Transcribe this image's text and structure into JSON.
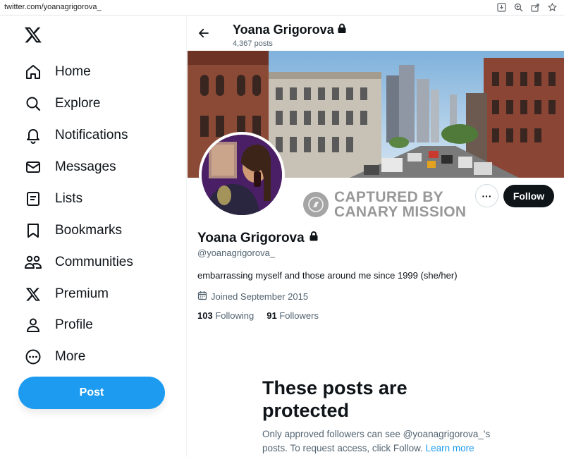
{
  "browser": {
    "url": "twitter.com/yoanagrigorova_"
  },
  "nav": {
    "items": [
      {
        "label": "Home",
        "icon": "home-icon"
      },
      {
        "label": "Explore",
        "icon": "search-icon"
      },
      {
        "label": "Notifications",
        "icon": "bell-icon"
      },
      {
        "label": "Messages",
        "icon": "mail-icon"
      },
      {
        "label": "Lists",
        "icon": "list-icon"
      },
      {
        "label": "Bookmarks",
        "icon": "bookmark-icon"
      },
      {
        "label": "Communities",
        "icon": "people-icon"
      },
      {
        "label": "Premium",
        "icon": "x-logo-icon"
      },
      {
        "label": "Profile",
        "icon": "person-icon"
      },
      {
        "label": "More",
        "icon": "more-circle-icon"
      }
    ],
    "post_label": "Post"
  },
  "header": {
    "name": "Yoana Grigorova",
    "posts_count": "4,367 posts"
  },
  "profile": {
    "name": "Yoana Grigorova",
    "handle": "@yoanagrigorova_",
    "bio": "embarrassing myself and those around me since 1999 (she/her)",
    "joined": "Joined September 2015",
    "following_count": "103",
    "following_label": "Following",
    "followers_count": "91",
    "followers_label": "Followers",
    "follow_label": "Follow",
    "more_label": "···"
  },
  "watermark": {
    "line1": "CAPTURED BY",
    "line2": "CANARY MISSION"
  },
  "protected": {
    "title": "These posts are protected",
    "desc": "Only approved followers can see @yoanagrigorova_'s posts. To request access, click Follow.",
    "learn_more": "Learn more"
  },
  "colors": {
    "accent": "#1d9bf0",
    "text": "#0f1419",
    "muted": "#536471"
  }
}
